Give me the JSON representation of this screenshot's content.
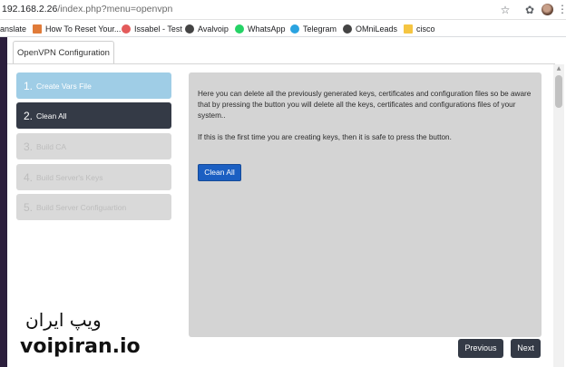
{
  "browser": {
    "url_host": "192.168.2.26",
    "url_path": "/index.php?menu=openvpn",
    "icons": [
      "star-icon",
      "extensions-icon",
      "profile-avatar",
      "menu-icon"
    ]
  },
  "bookmarks": [
    {
      "label": "anslate",
      "icon": "translate-icon",
      "color": "#ffffff"
    },
    {
      "label": "How To Reset Your...",
      "icon": "flag-icon",
      "color": "#e07b39"
    },
    {
      "label": "Issabel - Test",
      "icon": "issabel-icon",
      "color": "#e35b5b"
    },
    {
      "label": "Avalvoip",
      "icon": "globe-icon",
      "color": "#444444"
    },
    {
      "label": "WhatsApp",
      "icon": "whatsapp-icon",
      "color": "#25d366"
    },
    {
      "label": "Telegram",
      "icon": "telegram-icon",
      "color": "#2aa3e0"
    },
    {
      "label": "OMniLeads",
      "icon": "globe-icon",
      "color": "#444444"
    },
    {
      "label": "cisco",
      "icon": "folder-icon",
      "color": "#f5c542"
    }
  ],
  "tab": {
    "label": "OpenVPN Configuration"
  },
  "steps": [
    {
      "num": "1.",
      "label": "Create Vars File",
      "state": "done"
    },
    {
      "num": "2.",
      "label": "Clean All",
      "state": "active"
    },
    {
      "num": "3.",
      "label": "Build CA",
      "state": "disabled"
    },
    {
      "num": "4.",
      "label": "Build Server's Keys",
      "state": "disabled"
    },
    {
      "num": "5.",
      "label": "Build Server Configuartion",
      "state": "disabled"
    }
  ],
  "panel": {
    "text1": "Here you can delete all the previously generated keys, certificates and configuration files so be aware that by pressing the button you will delete all the keys, certificates and configurations files of your system..",
    "text2": "If this is the first time you are creating keys, then it is safe to press the button.",
    "button": "Clean All"
  },
  "nav": {
    "previous": "Previous",
    "next": "Next"
  },
  "watermark": {
    "fa": "ویپ ایران",
    "en": "voipiran.io"
  },
  "colors": {
    "step_done": "#9fcde6",
    "step_active": "#343a46",
    "step_disabled": "#d9d9d9",
    "primary_button": "#1b5fc2"
  }
}
